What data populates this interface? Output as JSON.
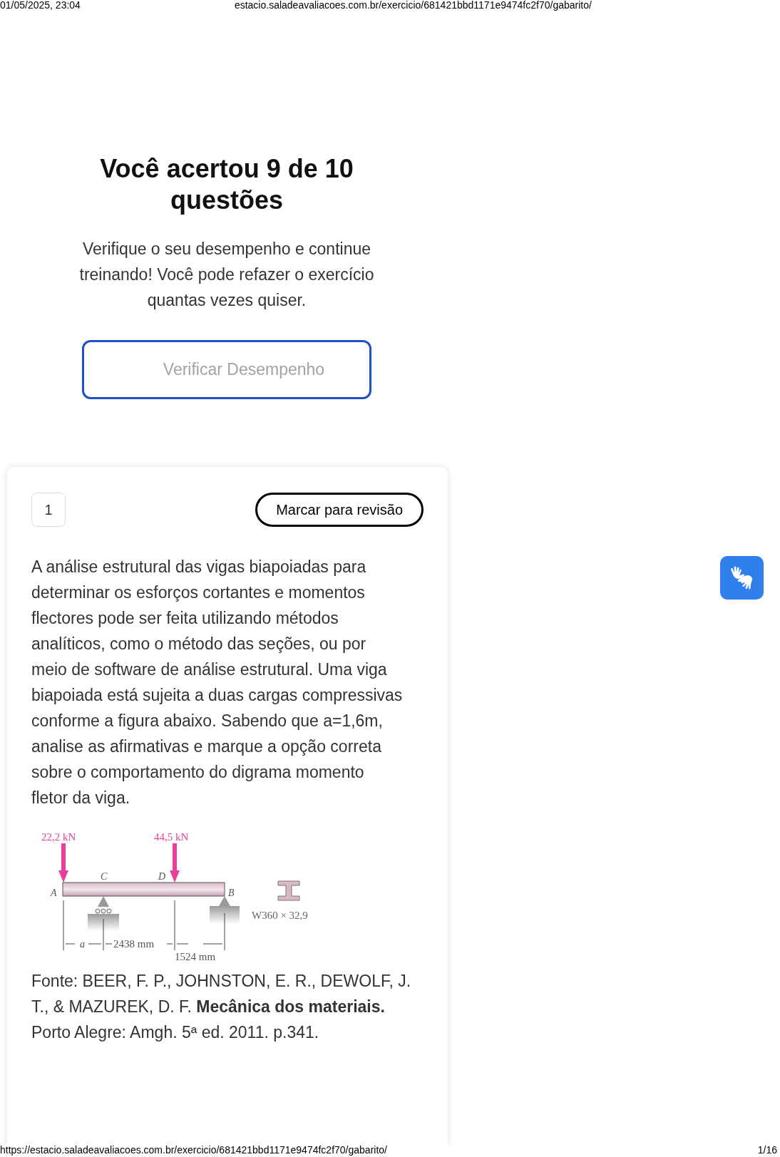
{
  "print_header": {
    "date": "01/05/2025, 23:04",
    "title": "estacio.saladeavaliacoes.com.br/exercicio/681421bbd1171e9474fc2f70/gabarito/"
  },
  "result": {
    "title": "Você acertou 9 de 10 questões",
    "message": "Verifique o seu desempenho e continue treinando! Você pode refazer o exercício quantas vezes quiser.",
    "button": "Verificar Desempenho"
  },
  "question": {
    "number": "1",
    "review_button": "Marcar para revisão",
    "statement": "A análise estrutural das vigas biapoiadas para determinar os esforços cortantes e momentos flectores pode ser feita utilizando métodos analíticos, como o método das seções, ou por meio de software de análise estrutural. Uma viga biapoiada está sujeita a duas cargas compressivas conforme a figura abaixo. Sabendo que a=1,6m, analise as afirmativas e marque a opção correta sobre o comportamento do digrama momento fletor da viga.",
    "figure": {
      "load_1": "22,2 kN",
      "load_2": "44,5 kN",
      "point_a": "A",
      "point_c": "C",
      "point_d": "D",
      "point_b": "B",
      "section": "W360 × 32,9",
      "dim_a": "a",
      "dim_cd": "2438 mm",
      "dim_db": "1524 mm"
    },
    "source": "Fonte: BEER, F. P., JOHNSTON, E. R., DEWOLF, J. T., & MAZUREK, D. F. **Mecânica dos materiais.** Porto Alegre: Amgh. 5ª ed. 2011. p.341."
  },
  "print_footer": {
    "url": "https://estacio.saladeavaliacoes.com.br/exercicio/681421bbd1171e9474fc2f70/gabarito/",
    "page": "1/16"
  }
}
